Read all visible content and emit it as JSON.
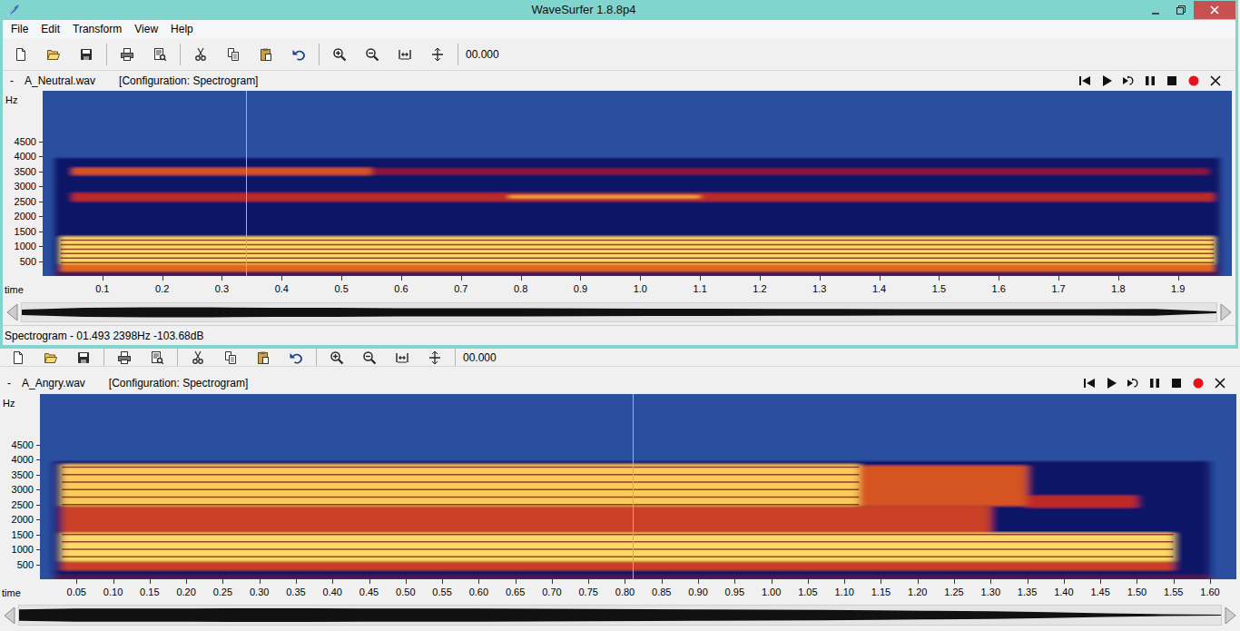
{
  "window": {
    "title": "WaveSurfer 1.8.8p4"
  },
  "menu": [
    "File",
    "Edit",
    "Transform",
    "View",
    "Help"
  ],
  "panes": [
    {
      "toolbar_time": "00.000",
      "collapse": "-",
      "file": "A_Neutral.wav",
      "configuration": "[Configuration: Spectrogram]",
      "y_axis": {
        "label": "Hz",
        "max_hz": 6200,
        "ticks": [
          "4500",
          "4000",
          "3500",
          "3000",
          "2500",
          "2000",
          "1500",
          "1000",
          "500"
        ]
      },
      "time_axis": {
        "label": "time",
        "duration": 1.99,
        "ticks": [
          "0.1",
          "0.2",
          "0.3",
          "0.4",
          "0.5",
          "0.6",
          "0.7",
          "0.8",
          "0.9",
          "1.0",
          "1.1",
          "1.2",
          "1.3",
          "1.4",
          "1.5",
          "1.6",
          "1.7",
          "1.8",
          "1.9"
        ]
      },
      "cursor": 0.34,
      "harmonic_spacing_hz": 150,
      "bands": [
        {
          "f0": 0,
          "f1": 3950,
          "t0": 0.02,
          "t1": 1.97,
          "level": 0.25
        },
        {
          "f0": 0,
          "f1": 130,
          "t0": 0.02,
          "t1": 1.97,
          "level": 0.35
        },
        {
          "f0": 150,
          "f1": 400,
          "t0": 0.03,
          "t1": 1.96,
          "level": 0.7
        },
        {
          "f0": 400,
          "f1": 1320,
          "t0": 0.03,
          "t1": 1.96,
          "level": 0.95
        },
        {
          "f0": 2500,
          "f1": 2780,
          "t0": 0.05,
          "t1": 1.96,
          "level": 0.55
        },
        {
          "f0": 2600,
          "f1": 2700,
          "t0": 0.78,
          "t1": 1.1,
          "level": 0.85
        },
        {
          "f0": 3380,
          "f1": 3620,
          "t0": 0.05,
          "t1": 0.55,
          "level": 0.65
        },
        {
          "f0": 3400,
          "f1": 3600,
          "t0": 0.55,
          "t1": 1.95,
          "level": 0.45
        }
      ],
      "waveform": [
        0.3,
        0.5,
        0.55,
        0.55,
        0.5,
        0.5,
        0.45,
        0.45,
        0.45,
        0.42,
        0.4,
        0.4,
        0.38,
        0.38,
        0.36,
        0.36,
        0.35,
        0.35,
        0.38,
        0.1
      ],
      "status": "Spectrogram - 01.493 2398Hz -103.68dB"
    },
    {
      "toolbar_time": "00.000",
      "collapse": "-",
      "file": "A_Angry.wav",
      "configuration": "[Configuration: Spectrogram]",
      "y_axis": {
        "label": "Hz",
        "max_hz": 6200,
        "ticks": [
          "4500",
          "4000",
          "3500",
          "3000",
          "2500",
          "2000",
          "1500",
          "1000",
          "500"
        ]
      },
      "time_axis": {
        "label": "time",
        "duration": 1.636,
        "ticks": [
          "0.05",
          "0.10",
          "0.15",
          "0.20",
          "0.25",
          "0.30",
          "0.35",
          "0.40",
          "0.45",
          "0.50",
          "0.55",
          "0.60",
          "0.65",
          "0.70",
          "0.75",
          "0.80",
          "0.85",
          "0.90",
          "0.95",
          "1.00",
          "1.05",
          "1.10",
          "1.15",
          "1.20",
          "1.25",
          "1.30",
          "1.35",
          "1.40",
          "1.45",
          "1.50",
          "1.55",
          "1.60"
        ]
      },
      "cursor": 0.81,
      "harmonic_spacing_hz": 250,
      "bands": [
        {
          "f0": 0,
          "f1": 3950,
          "t0": 0.02,
          "t1": 1.6,
          "level": 0.25
        },
        {
          "f0": 0,
          "f1": 150,
          "t0": 0.02,
          "t1": 1.6,
          "level": 0.35
        },
        {
          "f0": 300,
          "f1": 600,
          "t0": 0.03,
          "t1": 1.55,
          "level": 0.6
        },
        {
          "f0": 600,
          "f1": 1550,
          "t0": 0.03,
          "t1": 1.55,
          "level": 0.95
        },
        {
          "f0": 1550,
          "f1": 2450,
          "t0": 0.03,
          "t1": 1.3,
          "level": 0.6
        },
        {
          "f0": 2450,
          "f1": 3850,
          "t0": 0.03,
          "t1": 1.12,
          "level": 0.92
        },
        {
          "f0": 2450,
          "f1": 3800,
          "t0": 1.12,
          "t1": 1.35,
          "level": 0.65
        },
        {
          "f0": 2400,
          "f1": 2800,
          "t0": 1.35,
          "t1": 1.5,
          "level": 0.55
        }
      ],
      "waveform": [
        0.6,
        0.7,
        0.7,
        0.7,
        0.72,
        0.72,
        0.7,
        0.7,
        0.68,
        0.66,
        0.65,
        0.62,
        0.6,
        0.58,
        0.55,
        0.5,
        0.45,
        0.4,
        0.3,
        0.2,
        0.1,
        0.05
      ]
    }
  ]
}
